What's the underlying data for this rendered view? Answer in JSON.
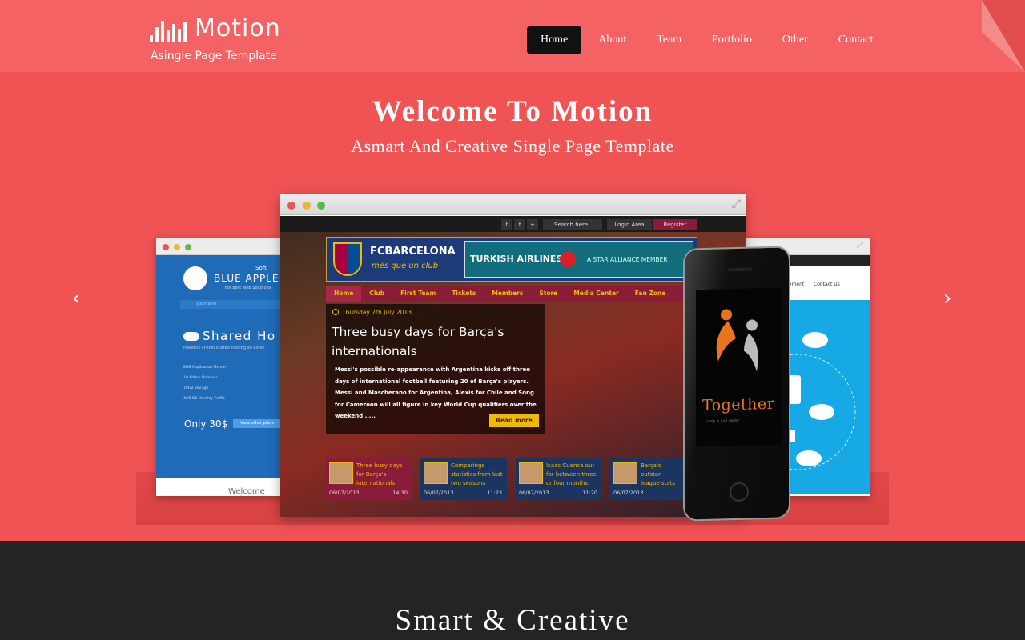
{
  "brand": {
    "title": "Motion",
    "tagline": "Asingle Page Template"
  },
  "nav": {
    "items": [
      "Home",
      "About",
      "Team",
      "Portfolio",
      "Other",
      "Contact"
    ],
    "active": "Home"
  },
  "hero": {
    "title": "Welcome To Motion",
    "subtitle": "Asmart And Creative Single Page Template",
    "prev_arrow": "‹",
    "next_arrow": "›"
  },
  "slide": {
    "left_mockup": {
      "brand": "BLUE APPLE",
      "brand_suffix": "Soft",
      "brand_tagline": "For best Web Solutions",
      "search_placeholder": "yourname",
      "heading": "Shared Ho",
      "description": "Powerful cPanel shared hosting an exten",
      "features": [
        "8GB Application Memory",
        "10 Addon Domains",
        "10GB Storage",
        "4GB DB Monthly Traffic"
      ],
      "price": "Only 30$",
      "plans_button": "View other plans",
      "footer_text": "Welcome"
    },
    "right_mockup": {
      "nav_items": [
        "yment",
        "Contact Us"
      ]
    },
    "main_mockup": {
      "utility": {
        "search_placeholder": "Search here",
        "login": "Login Area",
        "register": "Register"
      },
      "club_name": "FCBARCELONA",
      "club_motto": "més que un club",
      "sponsor": "TURKISH AIRLINES",
      "sponsor_alliance": "A STAR ALLIANCE MEMBER",
      "nav_items": [
        "Home",
        "Club",
        "First Team",
        "Tickets",
        "Members",
        "Store",
        "Media Center",
        "Fan Zone"
      ],
      "featured": {
        "date": "Thursday 7th July 2013",
        "title": "Three busy days for Barça's internationals",
        "body": "Messi's possible re-appearance with Argentina kicks off three days of international football featuring 20 of Barça's players. Messi and Mascherano for Argentina, Alexis for Chile and Song for Cameroon will all figure in key World Cup qualifiers over the weekend .....",
        "button": "Read more"
      },
      "thumbs": [
        {
          "text": "Three busy days for Barça's internationals",
          "date": "06/07/2013",
          "time": "14:30"
        },
        {
          "text": "Comparings statistics from last two seasons",
          "date": "06/07/2013",
          "time": "11:23"
        },
        {
          "text": "Isaac Cuenca out for between three or four months",
          "date": "06/07/2013",
          "time": "11:20"
        },
        {
          "text": "Barça's outstan league stats",
          "date": "06/07/2013",
          "time": ""
        }
      ]
    },
    "phone": {
      "app_name": "Together",
      "app_tagline": "only a call away"
    }
  },
  "section2": {
    "title": "Smart & Creative"
  },
  "colors": {
    "header": "#f46264",
    "hero": "#ef5354",
    "nav_active": "#111111",
    "dark": "#242424"
  }
}
